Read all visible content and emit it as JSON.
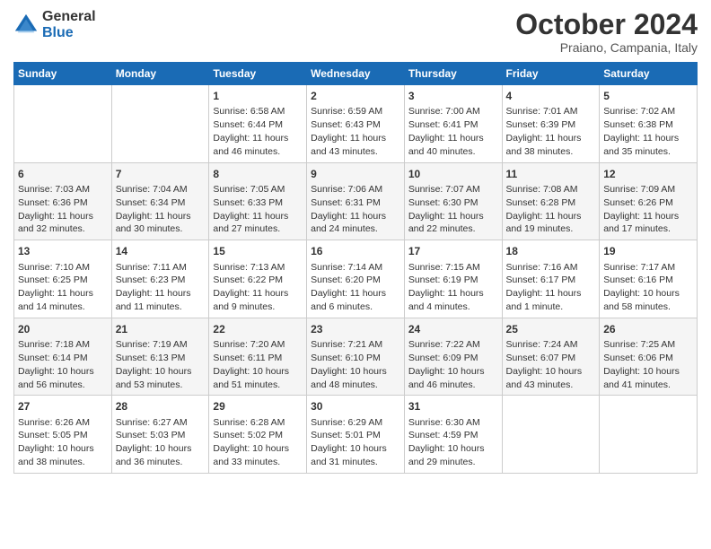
{
  "logo": {
    "general": "General",
    "blue": "Blue"
  },
  "header": {
    "title": "October 2024",
    "location": "Praiano, Campania, Italy"
  },
  "columns": [
    "Sunday",
    "Monday",
    "Tuesday",
    "Wednesday",
    "Thursday",
    "Friday",
    "Saturday"
  ],
  "weeks": [
    [
      {
        "day": "",
        "sunrise": "",
        "sunset": "",
        "daylight": ""
      },
      {
        "day": "",
        "sunrise": "",
        "sunset": "",
        "daylight": ""
      },
      {
        "day": "1",
        "sunrise": "Sunrise: 6:58 AM",
        "sunset": "Sunset: 6:44 PM",
        "daylight": "Daylight: 11 hours and 46 minutes."
      },
      {
        "day": "2",
        "sunrise": "Sunrise: 6:59 AM",
        "sunset": "Sunset: 6:43 PM",
        "daylight": "Daylight: 11 hours and 43 minutes."
      },
      {
        "day": "3",
        "sunrise": "Sunrise: 7:00 AM",
        "sunset": "Sunset: 6:41 PM",
        "daylight": "Daylight: 11 hours and 40 minutes."
      },
      {
        "day": "4",
        "sunrise": "Sunrise: 7:01 AM",
        "sunset": "Sunset: 6:39 PM",
        "daylight": "Daylight: 11 hours and 38 minutes."
      },
      {
        "day": "5",
        "sunrise": "Sunrise: 7:02 AM",
        "sunset": "Sunset: 6:38 PM",
        "daylight": "Daylight: 11 hours and 35 minutes."
      }
    ],
    [
      {
        "day": "6",
        "sunrise": "Sunrise: 7:03 AM",
        "sunset": "Sunset: 6:36 PM",
        "daylight": "Daylight: 11 hours and 32 minutes."
      },
      {
        "day": "7",
        "sunrise": "Sunrise: 7:04 AM",
        "sunset": "Sunset: 6:34 PM",
        "daylight": "Daylight: 11 hours and 30 minutes."
      },
      {
        "day": "8",
        "sunrise": "Sunrise: 7:05 AM",
        "sunset": "Sunset: 6:33 PM",
        "daylight": "Daylight: 11 hours and 27 minutes."
      },
      {
        "day": "9",
        "sunrise": "Sunrise: 7:06 AM",
        "sunset": "Sunset: 6:31 PM",
        "daylight": "Daylight: 11 hours and 24 minutes."
      },
      {
        "day": "10",
        "sunrise": "Sunrise: 7:07 AM",
        "sunset": "Sunset: 6:30 PM",
        "daylight": "Daylight: 11 hours and 22 minutes."
      },
      {
        "day": "11",
        "sunrise": "Sunrise: 7:08 AM",
        "sunset": "Sunset: 6:28 PM",
        "daylight": "Daylight: 11 hours and 19 minutes."
      },
      {
        "day": "12",
        "sunrise": "Sunrise: 7:09 AM",
        "sunset": "Sunset: 6:26 PM",
        "daylight": "Daylight: 11 hours and 17 minutes."
      }
    ],
    [
      {
        "day": "13",
        "sunrise": "Sunrise: 7:10 AM",
        "sunset": "Sunset: 6:25 PM",
        "daylight": "Daylight: 11 hours and 14 minutes."
      },
      {
        "day": "14",
        "sunrise": "Sunrise: 7:11 AM",
        "sunset": "Sunset: 6:23 PM",
        "daylight": "Daylight: 11 hours and 11 minutes."
      },
      {
        "day": "15",
        "sunrise": "Sunrise: 7:13 AM",
        "sunset": "Sunset: 6:22 PM",
        "daylight": "Daylight: 11 hours and 9 minutes."
      },
      {
        "day": "16",
        "sunrise": "Sunrise: 7:14 AM",
        "sunset": "Sunset: 6:20 PM",
        "daylight": "Daylight: 11 hours and 6 minutes."
      },
      {
        "day": "17",
        "sunrise": "Sunrise: 7:15 AM",
        "sunset": "Sunset: 6:19 PM",
        "daylight": "Daylight: 11 hours and 4 minutes."
      },
      {
        "day": "18",
        "sunrise": "Sunrise: 7:16 AM",
        "sunset": "Sunset: 6:17 PM",
        "daylight": "Daylight: 11 hours and 1 minute."
      },
      {
        "day": "19",
        "sunrise": "Sunrise: 7:17 AM",
        "sunset": "Sunset: 6:16 PM",
        "daylight": "Daylight: 10 hours and 58 minutes."
      }
    ],
    [
      {
        "day": "20",
        "sunrise": "Sunrise: 7:18 AM",
        "sunset": "Sunset: 6:14 PM",
        "daylight": "Daylight: 10 hours and 56 minutes."
      },
      {
        "day": "21",
        "sunrise": "Sunrise: 7:19 AM",
        "sunset": "Sunset: 6:13 PM",
        "daylight": "Daylight: 10 hours and 53 minutes."
      },
      {
        "day": "22",
        "sunrise": "Sunrise: 7:20 AM",
        "sunset": "Sunset: 6:11 PM",
        "daylight": "Daylight: 10 hours and 51 minutes."
      },
      {
        "day": "23",
        "sunrise": "Sunrise: 7:21 AM",
        "sunset": "Sunset: 6:10 PM",
        "daylight": "Daylight: 10 hours and 48 minutes."
      },
      {
        "day": "24",
        "sunrise": "Sunrise: 7:22 AM",
        "sunset": "Sunset: 6:09 PM",
        "daylight": "Daylight: 10 hours and 46 minutes."
      },
      {
        "day": "25",
        "sunrise": "Sunrise: 7:24 AM",
        "sunset": "Sunset: 6:07 PM",
        "daylight": "Daylight: 10 hours and 43 minutes."
      },
      {
        "day": "26",
        "sunrise": "Sunrise: 7:25 AM",
        "sunset": "Sunset: 6:06 PM",
        "daylight": "Daylight: 10 hours and 41 minutes."
      }
    ],
    [
      {
        "day": "27",
        "sunrise": "Sunrise: 6:26 AM",
        "sunset": "Sunset: 5:05 PM",
        "daylight": "Daylight: 10 hours and 38 minutes."
      },
      {
        "day": "28",
        "sunrise": "Sunrise: 6:27 AM",
        "sunset": "Sunset: 5:03 PM",
        "daylight": "Daylight: 10 hours and 36 minutes."
      },
      {
        "day": "29",
        "sunrise": "Sunrise: 6:28 AM",
        "sunset": "Sunset: 5:02 PM",
        "daylight": "Daylight: 10 hours and 33 minutes."
      },
      {
        "day": "30",
        "sunrise": "Sunrise: 6:29 AM",
        "sunset": "Sunset: 5:01 PM",
        "daylight": "Daylight: 10 hours and 31 minutes."
      },
      {
        "day": "31",
        "sunrise": "Sunrise: 6:30 AM",
        "sunset": "Sunset: 4:59 PM",
        "daylight": "Daylight: 10 hours and 29 minutes."
      },
      {
        "day": "",
        "sunrise": "",
        "sunset": "",
        "daylight": ""
      },
      {
        "day": "",
        "sunrise": "",
        "sunset": "",
        "daylight": ""
      }
    ]
  ]
}
